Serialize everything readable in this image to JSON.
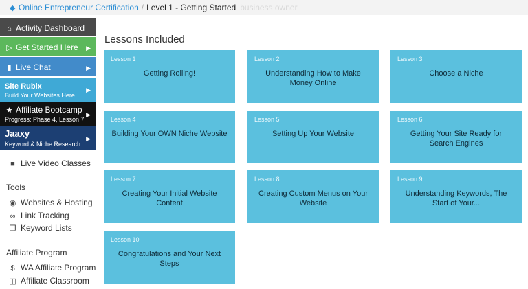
{
  "breadcrumb": {
    "root": "Online Entrepreneur Certification",
    "separator": "/",
    "current": "Level 1 - Getting Started",
    "ghost": "business owner"
  },
  "sidebar": {
    "activity_dashboard": "Activity Dashboard",
    "get_started": "Get Started Here",
    "live_chat": "Live Chat",
    "siterubix": {
      "brand": "Site Rubix",
      "subtitle": "Build Your Websites Here"
    },
    "affiliate_bootcamp": {
      "title": "Affiliate Bootcamp",
      "subtitle": "Progress: Phase 4, Lesson 7"
    },
    "jaaxy": {
      "brand": "Jaaxy",
      "subtitle": "Keyword & Niche Research"
    },
    "live_video_classes": "Live Video Classes",
    "tools_heading": "Tools",
    "tools": [
      "Websites & Hosting",
      "Link Tracking",
      "Keyword Lists"
    ],
    "affiliate_heading": "Affiliate Program",
    "affiliate": [
      "WA Affiliate Program",
      "Affiliate Classroom"
    ]
  },
  "main": {
    "title": "Lessons Included",
    "lessons": [
      {
        "num": "Lesson 1",
        "title": "Getting Rolling!"
      },
      {
        "num": "Lesson 2",
        "title": "Understanding How to Make Money Online"
      },
      {
        "num": "Lesson 3",
        "title": "Choose a Niche"
      },
      {
        "num": "Lesson 4",
        "title": "Building Your OWN Niche Website"
      },
      {
        "num": "Lesson 5",
        "title": "Setting Up Your Website"
      },
      {
        "num": "Lesson 6",
        "title": "Getting Your Site Ready for Search Engines"
      },
      {
        "num": "Lesson 7",
        "title": "Creating Your Initial Website Content"
      },
      {
        "num": "Lesson 8",
        "title": "Creating Custom Menus on Your Website"
      },
      {
        "num": "Lesson 9",
        "title": "Understanding Keywords, The Start of Your..."
      },
      {
        "num": "Lesson 10",
        "title": "Congratulations and Your Next Steps"
      }
    ]
  },
  "colors": {
    "card": "#5bc0de",
    "activity": "#4a4a4a",
    "get_started": "#5cb85c",
    "live_chat": "#428bca",
    "siterubix": "#3fa9d6",
    "bootcamp": "#111111",
    "jaaxy": "#1c3f73"
  }
}
